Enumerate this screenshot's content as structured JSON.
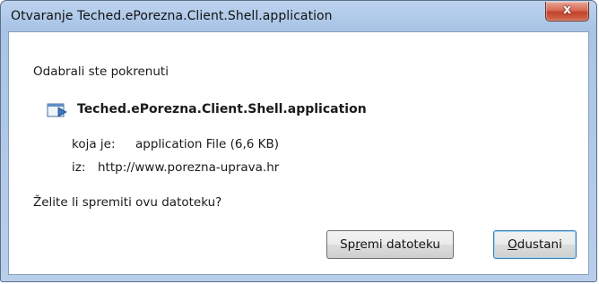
{
  "window": {
    "title": "Otvaranje Teched.ePorezna.Client.Shell.application",
    "close_glyph": "x"
  },
  "dialog": {
    "intro": "Odabrali ste pokrenuti",
    "file_name": "Teched.ePorezna.Client.Shell.application",
    "file_icon": "application-file-icon",
    "type_label": "koja je:",
    "type_value": "application File (6,6 KB)",
    "from_label": "iz:",
    "from_value": "http://www.porezna-uprava.hr",
    "question": "Želite li spremiti ovu datoteku?"
  },
  "buttons": {
    "save": {
      "pre": "Sp",
      "accel": "r",
      "post": "emi datoteku"
    },
    "cancel": {
      "pre": "",
      "accel": "O",
      "post": "dustani"
    }
  }
}
